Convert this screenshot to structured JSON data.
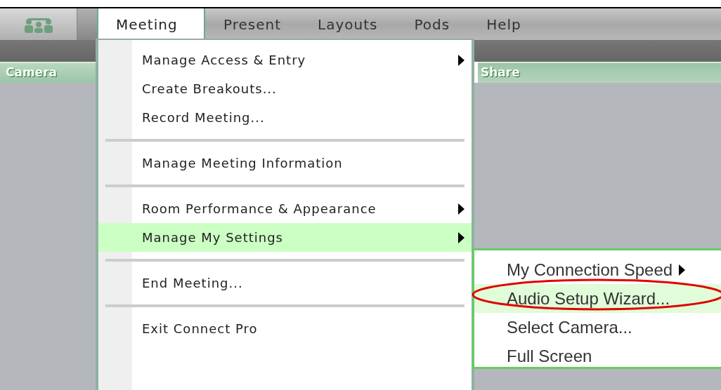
{
  "menu_bar": [
    {
      "label": "Meeting",
      "selected": true
    },
    {
      "label": "Present",
      "selected": false
    },
    {
      "label": "Layouts",
      "selected": false
    },
    {
      "label": "Pods",
      "selected": false
    },
    {
      "label": "Help",
      "selected": false
    }
  ],
  "pods": [
    {
      "title": "Camera"
    },
    {
      "title": "Share"
    }
  ],
  "menu": {
    "items": [
      {
        "kind": "item",
        "label": "Manage Access & Entry",
        "has_submenu": true,
        "selected": false
      },
      {
        "kind": "item",
        "label": "Create Breakouts...",
        "has_submenu": false,
        "selected": false
      },
      {
        "kind": "item",
        "label": "Record Meeting...",
        "has_submenu": false,
        "selected": false
      },
      {
        "kind": "separator"
      },
      {
        "kind": "item",
        "label": "Manage Meeting Information",
        "has_submenu": false,
        "selected": false
      },
      {
        "kind": "separator"
      },
      {
        "kind": "item",
        "label": "Room Performance & Appearance",
        "has_submenu": true,
        "selected": false
      },
      {
        "kind": "item",
        "label": "Manage My Settings",
        "has_submenu": true,
        "selected": true
      },
      {
        "kind": "separator"
      },
      {
        "kind": "item",
        "label": "End Meeting...",
        "has_submenu": false,
        "selected": false
      },
      {
        "kind": "separator"
      },
      {
        "kind": "item",
        "label": "Exit Connect Pro",
        "has_submenu": false,
        "selected": false
      }
    ]
  },
  "submenu": {
    "items": [
      {
        "label": "My Connection Speed",
        "has_submenu": true,
        "selected": false
      },
      {
        "label": "Audio Setup Wizard...",
        "has_submenu": false,
        "selected": true
      },
      {
        "label": "Select Camera...",
        "has_submenu": false,
        "selected": false
      },
      {
        "label": "Full Screen",
        "has_submenu": false,
        "selected": false
      }
    ]
  }
}
